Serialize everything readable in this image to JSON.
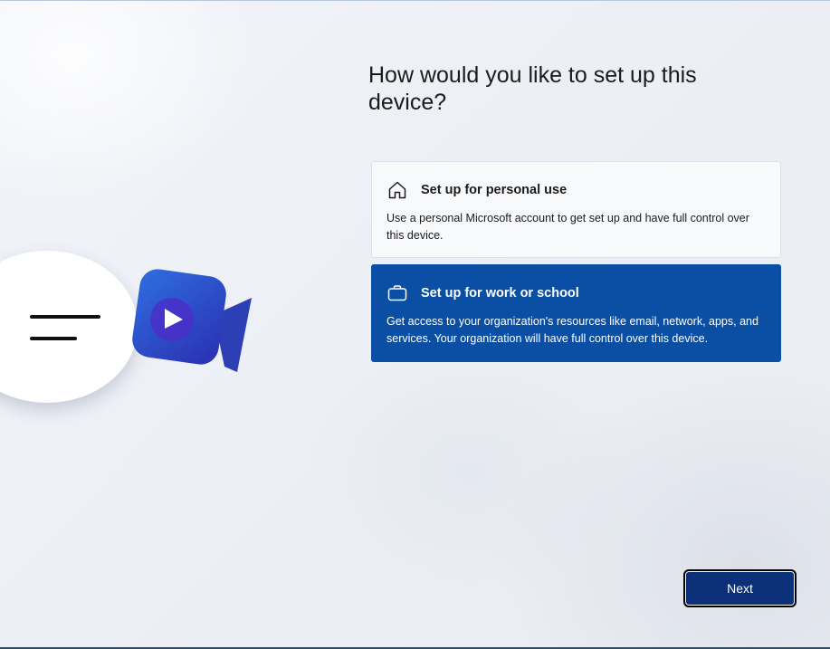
{
  "page": {
    "title": "How would you like to set up this device?"
  },
  "options": [
    {
      "icon": "home-icon",
      "title": "Set up for personal use",
      "description": "Use a personal Microsoft account to get set up and have full control over this device.",
      "selected": false
    },
    {
      "icon": "briefcase-icon",
      "title": "Set up for work or school",
      "description": "Get access to your organization's resources like email, network, apps, and services. Your organization will have full control over this device.",
      "selected": true
    }
  ],
  "illustration": {
    "icons": [
      "chat-bubble-icon",
      "video-camera-icon"
    ]
  },
  "footer": {
    "next_label": "Next"
  },
  "colors": {
    "selected_option": "#0a4fa3",
    "next_button": "#0c2f7a",
    "background": "#eef0f5"
  }
}
